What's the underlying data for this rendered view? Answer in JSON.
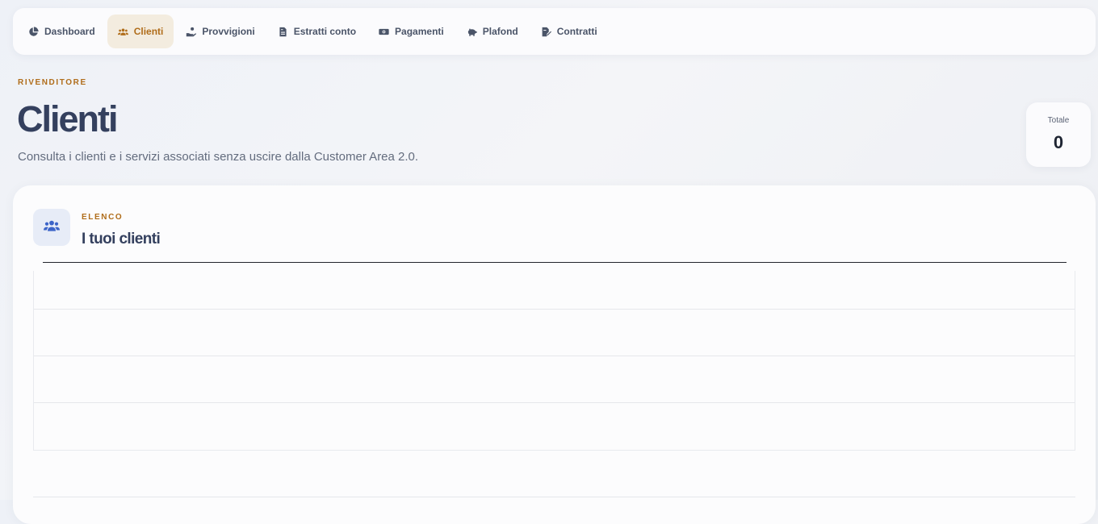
{
  "nav": {
    "items": [
      {
        "label": "Dashboard",
        "icon": "chart-pie-icon",
        "active": false
      },
      {
        "label": "Clienti",
        "icon": "users-icon",
        "active": true
      },
      {
        "label": "Provvigioni",
        "icon": "hand-coins-icon",
        "active": false
      },
      {
        "label": "Estratti conto",
        "icon": "file-invoice-icon",
        "active": false
      },
      {
        "label": "Pagamenti",
        "icon": "money-bill-icon",
        "active": false
      },
      {
        "label": "Plafond",
        "icon": "piggy-bank-icon",
        "active": false
      },
      {
        "label": "Contratti",
        "icon": "file-signature-icon",
        "active": false
      }
    ]
  },
  "header": {
    "eyebrow": "RIVENDITORE",
    "title": "Clienti",
    "subtitle": "Consulta i clienti e i servizi associati senza uscire dalla Customer Area 2.0."
  },
  "summary": {
    "total_label": "Totale",
    "total_value": "0"
  },
  "panel": {
    "icon": "users-icon",
    "eyebrow": "ELENCO",
    "title": "I tuoi clienti",
    "rows": []
  },
  "colors": {
    "accent": "#b06d1a",
    "active_tab_bg": "#f3ecdf",
    "title": "#34405e",
    "icon_blue": "#3c64c8"
  }
}
